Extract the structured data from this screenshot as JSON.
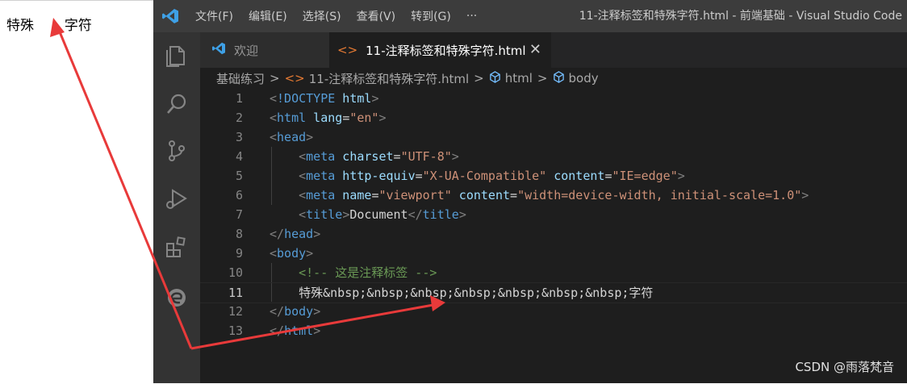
{
  "browser_preview": {
    "text": "特殊       字符"
  },
  "titlebar": {
    "menus": [
      "文件(F)",
      "编辑(E)",
      "选择(S)",
      "查看(V)",
      "转到(G)",
      "···"
    ],
    "window_title": "11-注释标签和特殊字符.html - 前端基础 - Visual Studio Code"
  },
  "tabs": {
    "welcome": "欢迎",
    "active": "11-注释标签和特殊字符.html",
    "active_icon": "<>",
    "close": "✕"
  },
  "breadcrumb": {
    "folder": "基础练习",
    "file": "11-注释标签和特殊字符.html",
    "file_icon": "<>",
    "html": "html",
    "body": "body",
    "sep": ">"
  },
  "code_lines": [
    {
      "n": "1",
      "t": [
        [
          "<",
          "p"
        ],
        [
          "!DOCTYPE",
          "tag"
        ],
        [
          " html",
          "attr"
        ],
        [
          ">",
          "p"
        ]
      ]
    },
    {
      "n": "2",
      "t": [
        [
          "<",
          "p"
        ],
        [
          "html",
          "tag"
        ],
        [
          " lang",
          "attr"
        ],
        [
          "=",
          "x"
        ],
        [
          "\"en\"",
          "s"
        ],
        [
          ">",
          "p"
        ]
      ]
    },
    {
      "n": "3",
      "t": [
        [
          "<",
          "p"
        ],
        [
          "head",
          "tag"
        ],
        [
          ">",
          "p"
        ]
      ]
    },
    {
      "n": "4",
      "t": [
        [
          "    ",
          "x"
        ],
        [
          "<",
          "p"
        ],
        [
          "meta",
          "tag"
        ],
        [
          " charset",
          "attr"
        ],
        [
          "=",
          "x"
        ],
        [
          "\"UTF-8\"",
          "s"
        ],
        [
          ">",
          "p"
        ]
      ]
    },
    {
      "n": "5",
      "t": [
        [
          "    ",
          "x"
        ],
        [
          "<",
          "p"
        ],
        [
          "meta",
          "tag"
        ],
        [
          " http-equiv",
          "attr"
        ],
        [
          "=",
          "x"
        ],
        [
          "\"X-UA-Compatible\"",
          "s"
        ],
        [
          " content",
          "attr"
        ],
        [
          "=",
          "x"
        ],
        [
          "\"IE=edge\"",
          "s"
        ],
        [
          ">",
          "p"
        ]
      ]
    },
    {
      "n": "6",
      "t": [
        [
          "    ",
          "x"
        ],
        [
          "<",
          "p"
        ],
        [
          "meta",
          "tag"
        ],
        [
          " name",
          "attr"
        ],
        [
          "=",
          "x"
        ],
        [
          "\"viewport\"",
          "s"
        ],
        [
          " content",
          "attr"
        ],
        [
          "=",
          "x"
        ],
        [
          "\"width=device-width, initial-scale=1.0\"",
          "s"
        ],
        [
          ">",
          "p"
        ]
      ]
    },
    {
      "n": "7",
      "t": [
        [
          "    ",
          "x"
        ],
        [
          "<",
          "p"
        ],
        [
          "title",
          "tag"
        ],
        [
          ">",
          "p"
        ],
        [
          "Document",
          "x"
        ],
        [
          "</",
          "p"
        ],
        [
          "title",
          "tag"
        ],
        [
          ">",
          "p"
        ]
      ]
    },
    {
      "n": "8",
      "t": [
        [
          "</",
          "p"
        ],
        [
          "head",
          "tag"
        ],
        [
          ">",
          "p"
        ]
      ]
    },
    {
      "n": "9",
      "t": [
        [
          "<",
          "p"
        ],
        [
          "body",
          "tag"
        ],
        [
          ">",
          "p"
        ]
      ]
    },
    {
      "n": "10",
      "t": [
        [
          "    ",
          "x"
        ],
        [
          "<!-- 这是注释标签 -->",
          "c"
        ]
      ]
    },
    {
      "n": "11",
      "t": [
        [
          "    特殊&nbsp;&nbsp;&nbsp;&nbsp;&nbsp;&nbsp;&nbsp;字符",
          "x"
        ]
      ]
    },
    {
      "n": "12",
      "t": [
        [
          "</",
          "p"
        ],
        [
          "body",
          "tag"
        ],
        [
          ">",
          "p"
        ]
      ]
    },
    {
      "n": "13",
      "t": [
        [
          "</",
          "p"
        ],
        [
          "html",
          "tag"
        ],
        [
          ">",
          "p"
        ]
      ]
    }
  ],
  "watermark": "CSDN @雨落梵音",
  "colors": {
    "arrow": "#e83a3a",
    "editor_bg": "#1e1e1e",
    "titlebar_bg": "#3c3c3c",
    "activitybar_bg": "#333333"
  }
}
